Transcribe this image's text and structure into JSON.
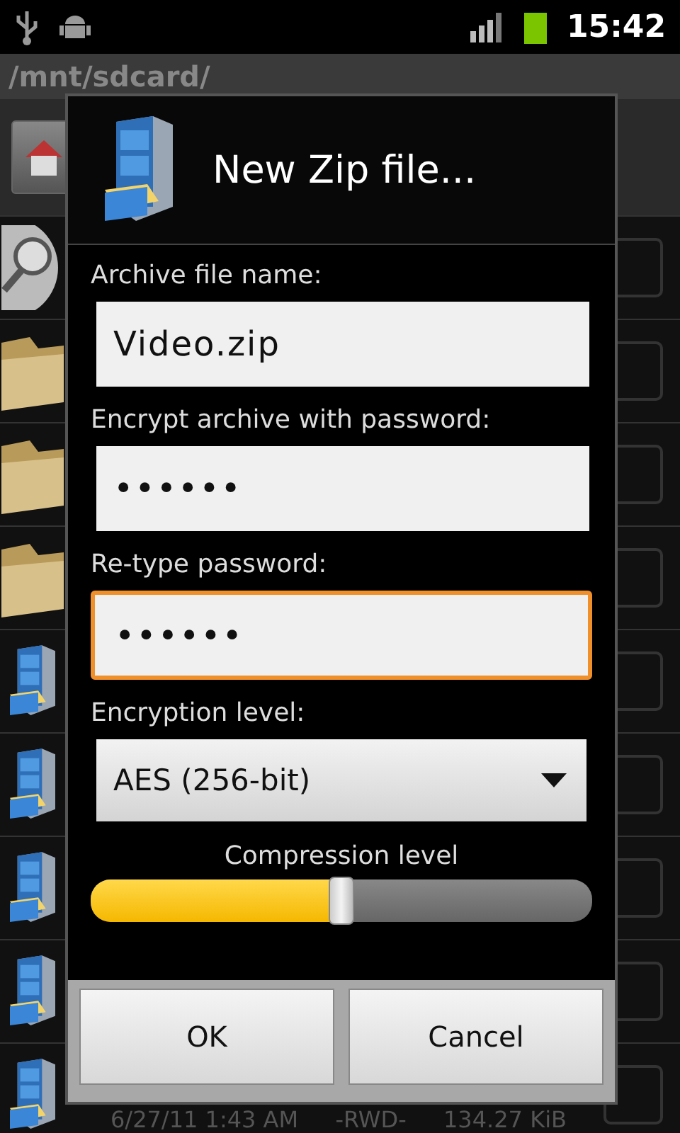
{
  "status_bar": {
    "time": "15:42"
  },
  "path_bar": {
    "path": "/mnt/sdcard/"
  },
  "file_list": {
    "rows": [
      {
        "kind": "search",
        "checked": false
      },
      {
        "kind": "folder",
        "checked": false
      },
      {
        "kind": "folder",
        "checked": false
      },
      {
        "kind": "folder",
        "checked": false
      },
      {
        "kind": "archive",
        "checked": false
      },
      {
        "kind": "archive",
        "checked": false
      },
      {
        "kind": "archive",
        "checked": false
      },
      {
        "kind": "archive",
        "checked": false
      },
      {
        "kind": "archive",
        "checked": false,
        "date": "6/27/11 1:43 AM",
        "permissions": "-RWD-",
        "size": "134.27 KiB"
      }
    ]
  },
  "dialog": {
    "title": "New Zip file...",
    "fields": [
      {
        "label": "Archive file name:",
        "value": "Video.zip",
        "focused": false
      },
      {
        "label": "Encrypt archive with password:",
        "value": "••••••",
        "focused": false
      },
      {
        "label": "Re-type password:",
        "value": "••••••",
        "focused": true
      }
    ],
    "encryption": {
      "label": "Encryption level:",
      "value": "AES (256-bit)"
    },
    "compression": {
      "label": "Compression level",
      "level": 0.5
    },
    "buttons": [
      "OK",
      "Cancel"
    ]
  }
}
